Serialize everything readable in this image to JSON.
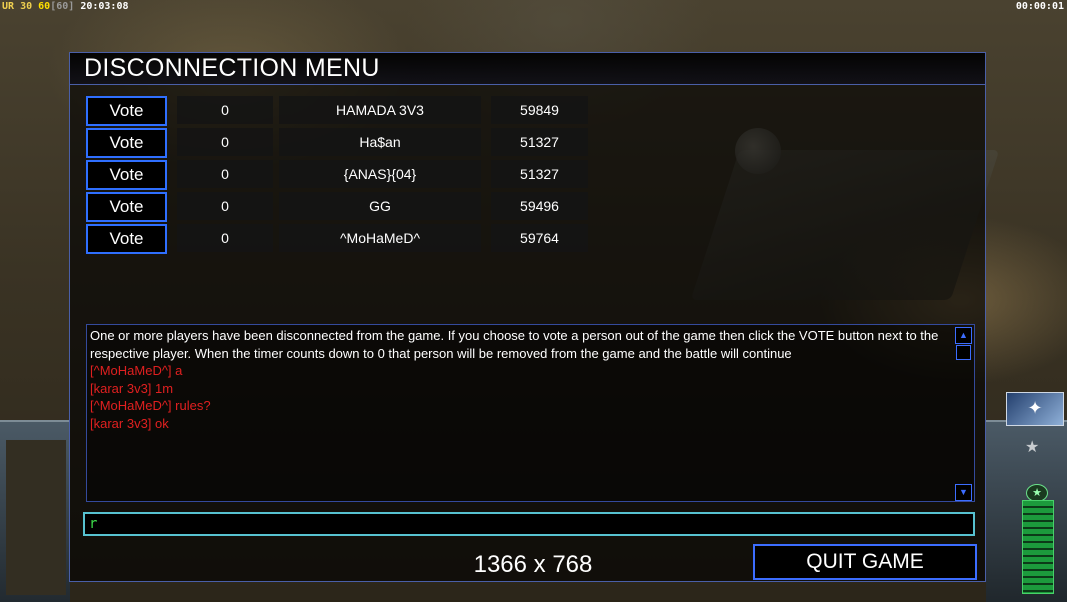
{
  "hud": {
    "ur_label": "UR",
    "ur_value": "30",
    "fps": "60",
    "fps_bracket": "[60]",
    "clock": "20:03:08",
    "timer": "00:00:01"
  },
  "dialog": {
    "title": "DISCONNECTION MENU",
    "vote_label": "Vote",
    "players": [
      {
        "votes": "0",
        "name": "HAMADA 3V3",
        "ping": "59849"
      },
      {
        "votes": "0",
        "name": "Ha$an",
        "ping": "51327"
      },
      {
        "votes": "0",
        "name": "{ANAS}{04}",
        "ping": "51327"
      },
      {
        "votes": "0",
        "name": "GG",
        "ping": "59496"
      },
      {
        "votes": "0",
        "name": "^MoHaMeD^",
        "ping": "59764"
      }
    ],
    "chat": {
      "system_message": "One or more players have been disconnected from the game. If you choose to vote a person out of the game then click the VOTE button next to the respective player. When the timer counts down to 0 that person will be removed from the game and the battle will continue",
      "messages": [
        "[^MoHaMeD^] a",
        "[karar 3v3] 1m",
        "[^MoHaMeD^] rules?",
        "[karar 3v3] ok"
      ]
    },
    "input_value": "r",
    "resolution": "1366 x 768",
    "quit_label": "QUIT GAME"
  },
  "colors": {
    "button_border": "#2f6fff",
    "chat_message": "#e02020",
    "input_border": "#57c2d0"
  }
}
